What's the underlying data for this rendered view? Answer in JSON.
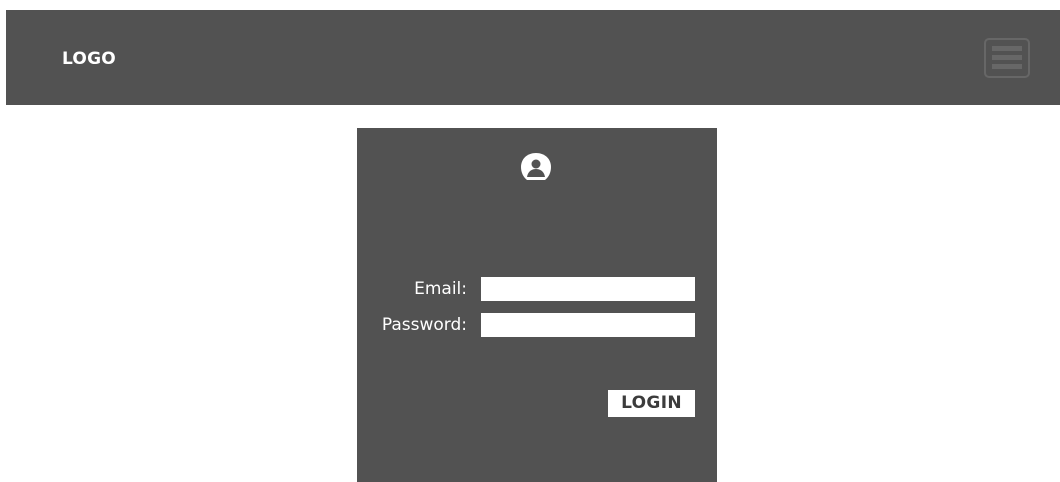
{
  "header": {
    "logo_text": "LOGO",
    "menu_icon": "hamburger-menu-icon"
  },
  "login_panel": {
    "user_icon": "user-avatar-icon",
    "email": {
      "label": "Email:",
      "value": "",
      "placeholder": ""
    },
    "password": {
      "label": "Password:",
      "value": "",
      "placeholder": ""
    },
    "login_button_label": "LOGIN"
  },
  "colors": {
    "panel_background": "#525252",
    "page_background": "#ffffff",
    "text_light": "#ffffff",
    "button_text": "#3c3c3c"
  }
}
